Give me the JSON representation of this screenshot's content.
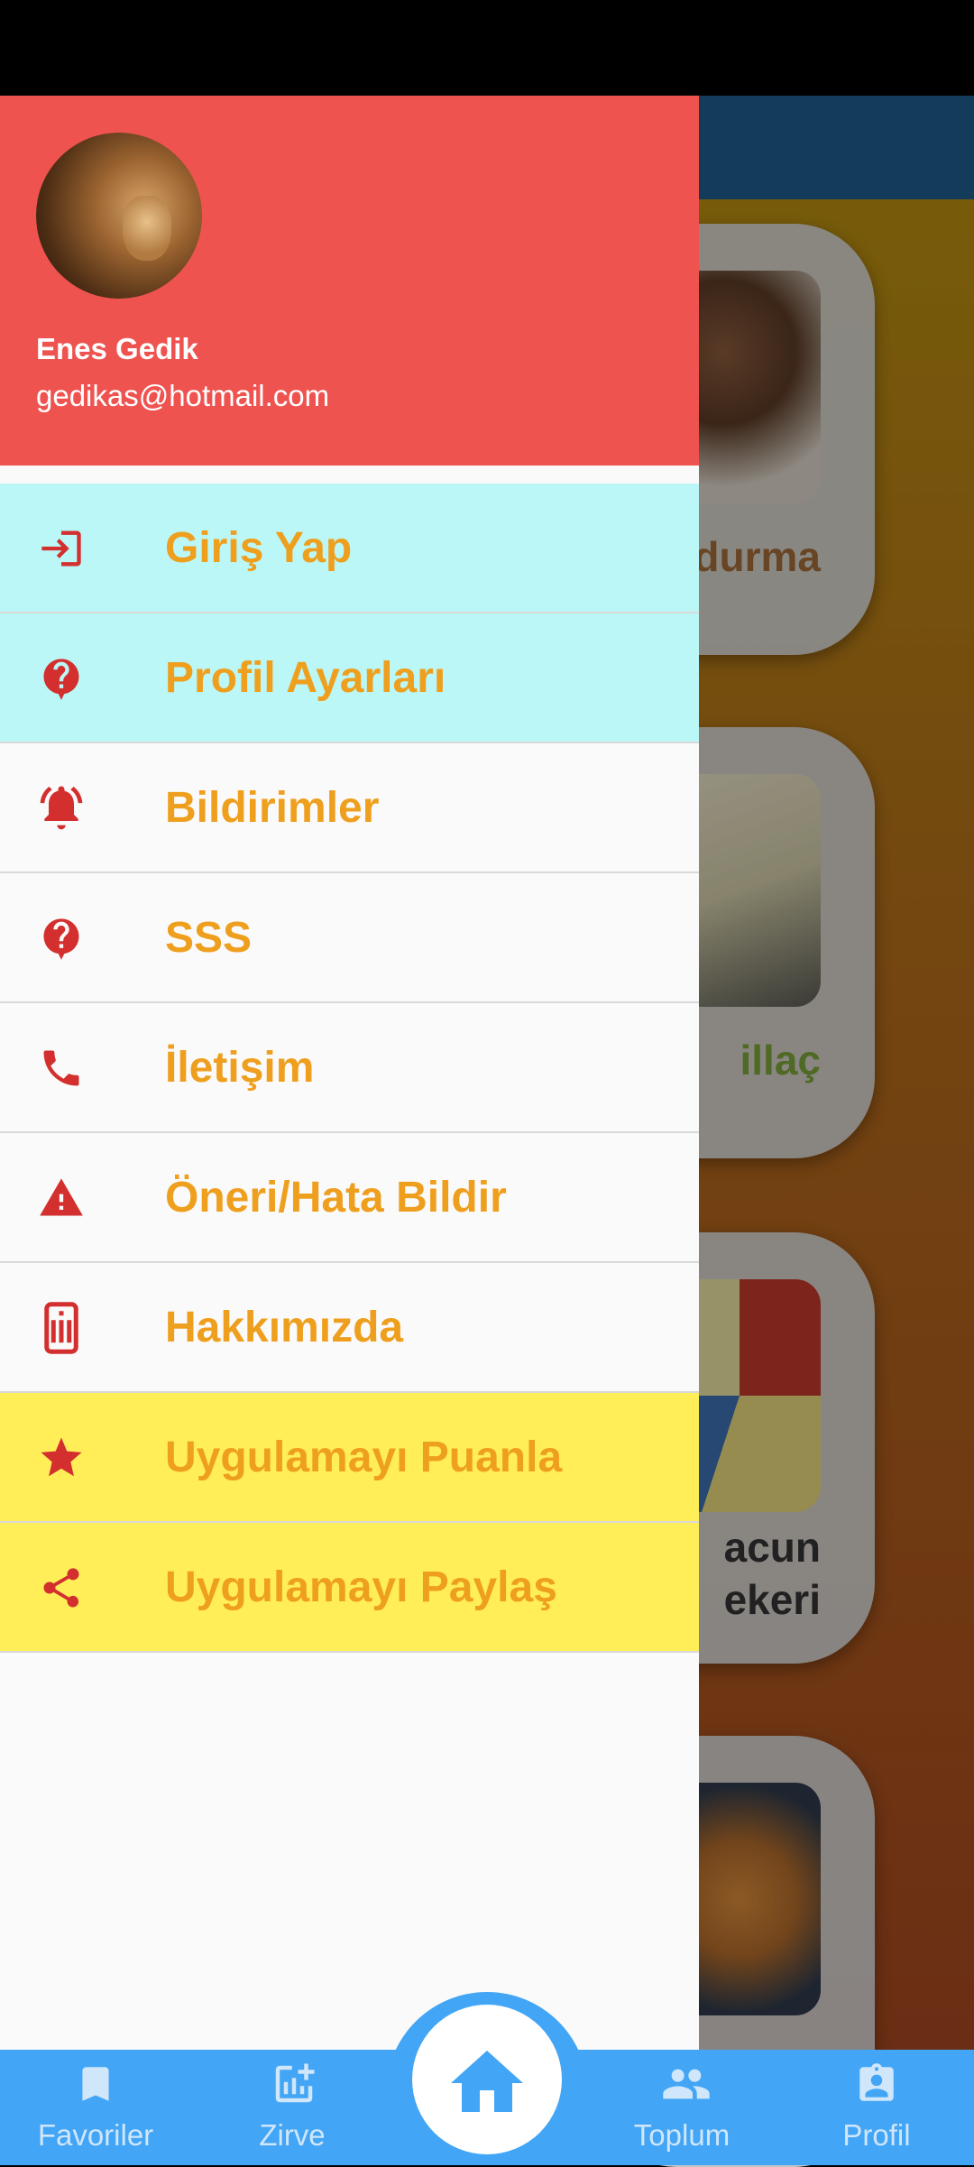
{
  "drawer": {
    "user_name": "Enes Gedik",
    "user_email": "gedikas@hotmail.com",
    "items": [
      {
        "label": "Giriş Yap",
        "icon": "login-icon"
      },
      {
        "label": "Profil Ayarları",
        "icon": "help-bubble-icon"
      },
      {
        "label": "Bildirimler",
        "icon": "bell-ringing-icon"
      },
      {
        "label": "SSS",
        "icon": "help-bubble-icon"
      },
      {
        "label": "İletişim",
        "icon": "phone-icon"
      },
      {
        "label": "Öneri/Hata Bildir",
        "icon": "warning-icon"
      },
      {
        "label": "Hakkımızda",
        "icon": "info-device-icon"
      },
      {
        "label": "Uygulamayı Puanla",
        "icon": "star-icon"
      },
      {
        "label": "Uygulamayı Paylaş",
        "icon": "share-icon"
      }
    ]
  },
  "background_cards": [
    {
      "title_visible": "durma"
    },
    {
      "title_visible": "illaç"
    },
    {
      "title_visible": "acun\nekeri"
    },
    {
      "title_visible": ""
    }
  ],
  "bottom_nav": {
    "items": [
      {
        "label": "Favoriler",
        "icon": "bookmark-icon"
      },
      {
        "label": "Zirve",
        "icon": "chart-add-icon"
      },
      {
        "label": "Toplum",
        "icon": "people-icon"
      },
      {
        "label": "Profil",
        "icon": "profile-badge-icon"
      }
    ],
    "center_icon": "home-icon"
  },
  "colors": {
    "header": "#ef5350",
    "icon_red": "#d32f2f",
    "label_orange": "#ef9f1e",
    "cyan_row": "#bbf7f7",
    "yellow_row": "#ffee58",
    "nav_blue": "#42a5f5"
  }
}
